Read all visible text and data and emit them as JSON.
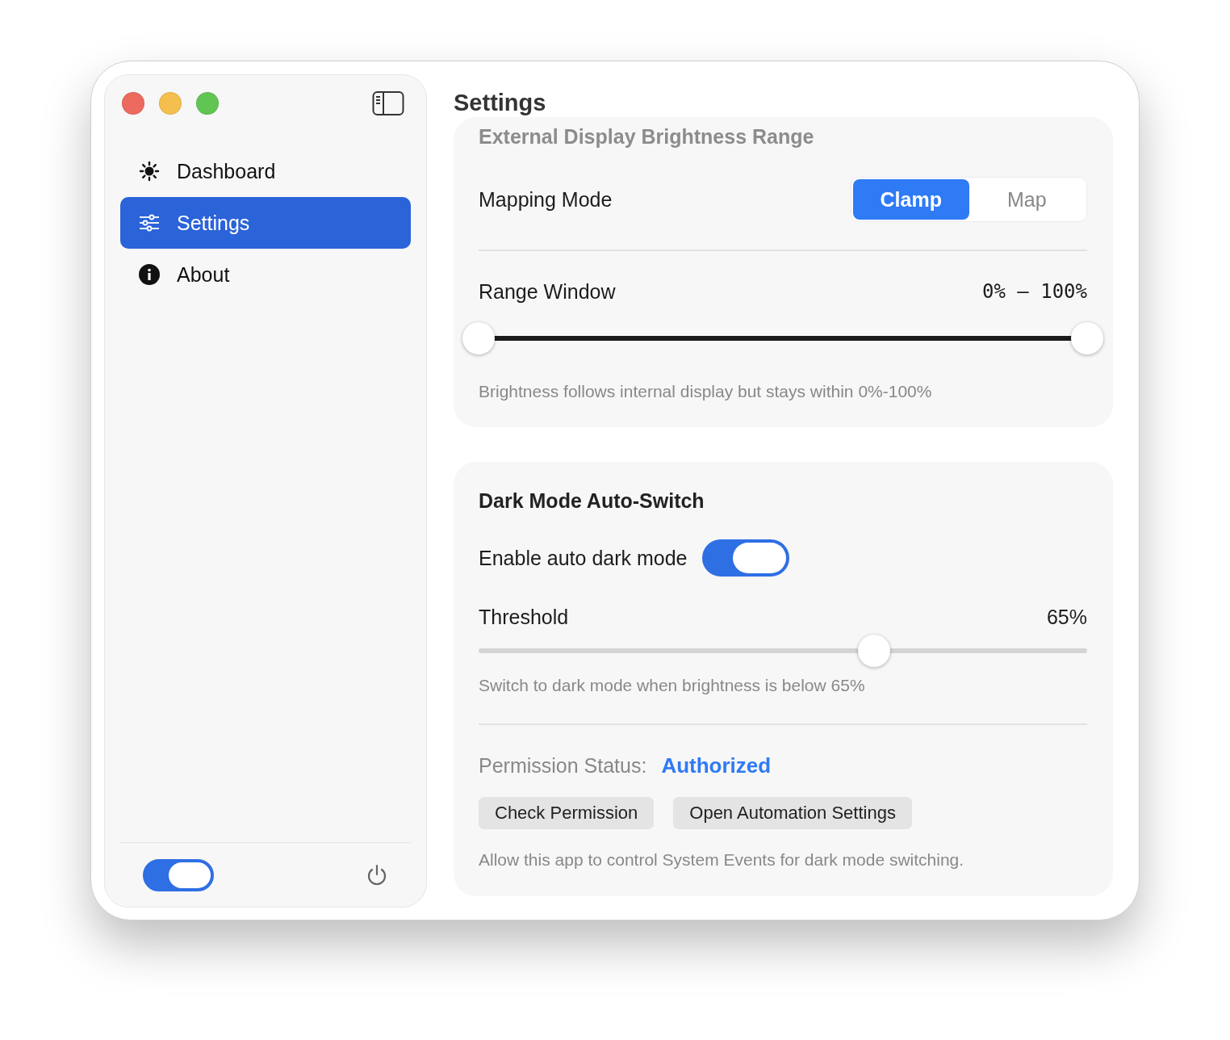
{
  "sidebar": {
    "items": [
      {
        "label": "Dashboard",
        "kind": "sun",
        "selected": false
      },
      {
        "label": "Settings",
        "kind": "sliders",
        "selected": true
      },
      {
        "label": "About",
        "kind": "info",
        "selected": false
      }
    ],
    "footer_toggle": {
      "on": true
    }
  },
  "main": {
    "title": "Settings",
    "brightness_card": {
      "header": "External Display Brightness Range",
      "mapping_mode": {
        "label": "Mapping Mode",
        "options": [
          {
            "label": "Clamp",
            "selected": true
          },
          {
            "label": "Map",
            "selected": false
          }
        ]
      },
      "range": {
        "label": "Range Window",
        "reading": "0% – 100%",
        "thumbs": [
          {
            "level": 0
          },
          {
            "level": 1
          }
        ]
      },
      "caption": "Brightness follows internal display but stays within 0%-100%"
    },
    "dark_mode_card": {
      "header": "Dark Mode Auto-Switch",
      "enable": {
        "label": "Enable auto dark mode",
        "on": true
      },
      "threshold": {
        "label": "Threshold",
        "reading": "65%",
        "level": 0.65
      },
      "caption": "Switch to dark mode when brightness is below 65%",
      "permission": {
        "label": "Permission Status:",
        "value": "Authorized"
      },
      "buttons": [
        "Check Permission",
        "Open Automation Settings"
      ],
      "note": "Allow this app to control System Events for dark mode switching."
    }
  }
}
